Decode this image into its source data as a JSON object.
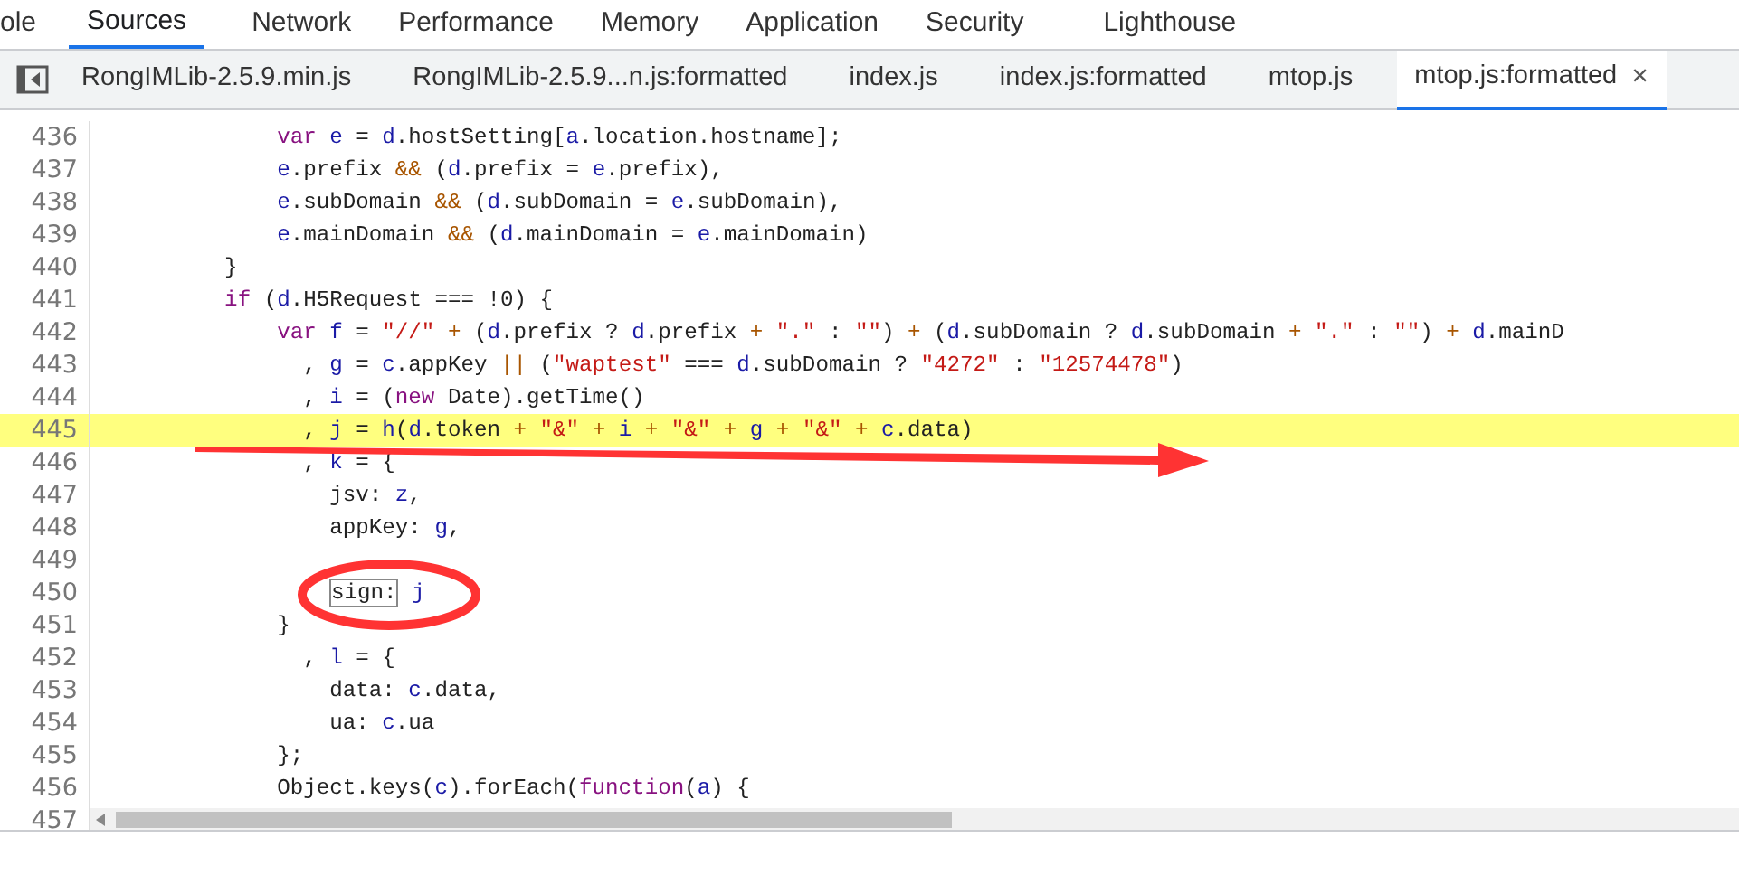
{
  "panel_tabs": [
    {
      "label": "ole",
      "selected": false
    },
    {
      "label": "Sources",
      "selected": true
    },
    {
      "label": "Network",
      "selected": false
    },
    {
      "label": "Performance",
      "selected": false
    },
    {
      "label": "Memory",
      "selected": false
    },
    {
      "label": "Application",
      "selected": false
    },
    {
      "label": "Security",
      "selected": false
    },
    {
      "label": "Lighthouse",
      "selected": false
    }
  ],
  "file_tabs": [
    {
      "label": "RongIMLib-2.5.9.min.js",
      "selected": false
    },
    {
      "label": "RongIMLib-2.5.9...n.js:formatted",
      "selected": false
    },
    {
      "label": "index.js",
      "selected": false
    },
    {
      "label": "index.js:formatted",
      "selected": false
    },
    {
      "label": "mtop.js",
      "selected": false
    },
    {
      "label": "mtop.js:formatted",
      "selected": true,
      "close": "×"
    }
  ],
  "code_lines": [
    {
      "number": "436",
      "highlighted": false,
      "segments": [
        {
          "kind": "kw",
          "t": "            var "
        },
        {
          "kind": "var",
          "t": "e "
        },
        {
          "kind": "plain",
          "t": "= "
        },
        {
          "kind": "var",
          "t": "d"
        },
        {
          "kind": "plain",
          "t": ".hostSetting["
        },
        {
          "kind": "var",
          "t": "a"
        },
        {
          "kind": "plain",
          "t": ".location.hostname];"
        }
      ]
    },
    {
      "number": "437",
      "highlighted": false,
      "segments": [
        {
          "kind": "var",
          "t": "            e"
        },
        {
          "kind": "plain",
          "t": ".prefix "
        },
        {
          "kind": "op",
          "t": "&& "
        },
        {
          "kind": "plain",
          "t": "("
        },
        {
          "kind": "var",
          "t": "d"
        },
        {
          "kind": "plain",
          "t": ".prefix = "
        },
        {
          "kind": "var",
          "t": "e"
        },
        {
          "kind": "plain",
          "t": ".prefix),"
        }
      ]
    },
    {
      "number": "438",
      "highlighted": false,
      "segments": [
        {
          "kind": "var",
          "t": "            e"
        },
        {
          "kind": "plain",
          "t": ".subDomain "
        },
        {
          "kind": "op",
          "t": "&& "
        },
        {
          "kind": "plain",
          "t": "("
        },
        {
          "kind": "var",
          "t": "d"
        },
        {
          "kind": "plain",
          "t": ".subDomain = "
        },
        {
          "kind": "var",
          "t": "e"
        },
        {
          "kind": "plain",
          "t": ".subDomain),"
        }
      ]
    },
    {
      "number": "439",
      "highlighted": false,
      "segments": [
        {
          "kind": "var",
          "t": "            e"
        },
        {
          "kind": "plain",
          "t": ".mainDomain "
        },
        {
          "kind": "op",
          "t": "&& "
        },
        {
          "kind": "plain",
          "t": "("
        },
        {
          "kind": "var",
          "t": "d"
        },
        {
          "kind": "plain",
          "t": ".mainDomain = "
        },
        {
          "kind": "var",
          "t": "e"
        },
        {
          "kind": "plain",
          "t": ".mainDomain)"
        }
      ]
    },
    {
      "number": "440",
      "highlighted": false,
      "segments": [
        {
          "kind": "plain",
          "t": "        }"
        }
      ]
    },
    {
      "number": "441",
      "highlighted": false,
      "segments": [
        {
          "kind": "kw",
          "t": "        if "
        },
        {
          "kind": "plain",
          "t": "("
        },
        {
          "kind": "var",
          "t": "d"
        },
        {
          "kind": "plain",
          "t": ".H5Request === !0) {"
        }
      ]
    },
    {
      "number": "442",
      "highlighted": false,
      "segments": [
        {
          "kind": "kw",
          "t": "            var "
        },
        {
          "kind": "var",
          "t": "f "
        },
        {
          "kind": "plain",
          "t": "= "
        },
        {
          "kind": "str",
          "t": "\"//\" "
        },
        {
          "kind": "op",
          "t": "+ "
        },
        {
          "kind": "plain",
          "t": "("
        },
        {
          "kind": "var",
          "t": "d"
        },
        {
          "kind": "plain",
          "t": ".prefix ? "
        },
        {
          "kind": "var",
          "t": "d"
        },
        {
          "kind": "plain",
          "t": ".prefix "
        },
        {
          "kind": "op",
          "t": "+ "
        },
        {
          "kind": "str",
          "t": "\".\" "
        },
        {
          "kind": "plain",
          "t": ": "
        },
        {
          "kind": "str",
          "t": "\"\""
        },
        {
          "kind": "plain",
          "t": ") "
        },
        {
          "kind": "op",
          "t": "+ "
        },
        {
          "kind": "plain",
          "t": "("
        },
        {
          "kind": "var",
          "t": "d"
        },
        {
          "kind": "plain",
          "t": ".subDomain ? "
        },
        {
          "kind": "var",
          "t": "d"
        },
        {
          "kind": "plain",
          "t": ".subDomain "
        },
        {
          "kind": "op",
          "t": "+ "
        },
        {
          "kind": "str",
          "t": "\".\" "
        },
        {
          "kind": "plain",
          "t": ": "
        },
        {
          "kind": "str",
          "t": "\"\""
        },
        {
          "kind": "plain",
          "t": ") "
        },
        {
          "kind": "op",
          "t": "+ "
        },
        {
          "kind": "var",
          "t": "d"
        },
        {
          "kind": "plain",
          "t": ".mainD"
        }
      ]
    },
    {
      "number": "443",
      "highlighted": false,
      "segments": [
        {
          "kind": "plain",
          "t": "              , "
        },
        {
          "kind": "var",
          "t": "g "
        },
        {
          "kind": "plain",
          "t": "= "
        },
        {
          "kind": "var",
          "t": "c"
        },
        {
          "kind": "plain",
          "t": ".appKey "
        },
        {
          "kind": "op",
          "t": "|| "
        },
        {
          "kind": "plain",
          "t": "("
        },
        {
          "kind": "str",
          "t": "\"waptest\" "
        },
        {
          "kind": "plain",
          "t": "=== "
        },
        {
          "kind": "var",
          "t": "d"
        },
        {
          "kind": "plain",
          "t": ".subDomain ? "
        },
        {
          "kind": "str",
          "t": "\"4272\" "
        },
        {
          "kind": "plain",
          "t": ": "
        },
        {
          "kind": "str",
          "t": "\"12574478\""
        },
        {
          "kind": "plain",
          "t": ")"
        }
      ]
    },
    {
      "number": "444",
      "highlighted": false,
      "segments": [
        {
          "kind": "plain",
          "t": "              , "
        },
        {
          "kind": "var",
          "t": "i "
        },
        {
          "kind": "plain",
          "t": "= ("
        },
        {
          "kind": "kw",
          "t": "new "
        },
        {
          "kind": "plain",
          "t": "Date).getTime()"
        }
      ]
    },
    {
      "number": "445",
      "highlighted": true,
      "segments": [
        {
          "kind": "plain",
          "t": "              , "
        },
        {
          "kind": "var",
          "t": "j "
        },
        {
          "kind": "plain",
          "t": "= "
        },
        {
          "kind": "var",
          "t": "h"
        },
        {
          "kind": "plain",
          "t": "("
        },
        {
          "kind": "var",
          "t": "d"
        },
        {
          "kind": "plain",
          "t": ".token "
        },
        {
          "kind": "op",
          "t": "+ "
        },
        {
          "kind": "str",
          "t": "\"&\" "
        },
        {
          "kind": "op",
          "t": "+ "
        },
        {
          "kind": "var",
          "t": "i "
        },
        {
          "kind": "op",
          "t": "+ "
        },
        {
          "kind": "str",
          "t": "\"&\" "
        },
        {
          "kind": "op",
          "t": "+ "
        },
        {
          "kind": "var",
          "t": "g "
        },
        {
          "kind": "op",
          "t": "+ "
        },
        {
          "kind": "str",
          "t": "\"&\" "
        },
        {
          "kind": "op",
          "t": "+ "
        },
        {
          "kind": "var",
          "t": "c"
        },
        {
          "kind": "plain",
          "t": ".data)"
        }
      ]
    },
    {
      "number": "446",
      "highlighted": false,
      "segments": [
        {
          "kind": "plain",
          "t": "              , "
        },
        {
          "kind": "var",
          "t": "k "
        },
        {
          "kind": "plain",
          "t": "= {"
        }
      ]
    },
    {
      "number": "447",
      "highlighted": false,
      "segments": [
        {
          "kind": "plain",
          "t": "                jsv: "
        },
        {
          "kind": "var",
          "t": "z"
        },
        {
          "kind": "plain",
          "t": ","
        }
      ]
    },
    {
      "number": "448",
      "highlighted": false,
      "segments": [
        {
          "kind": "plain",
          "t": "                appKey: "
        },
        {
          "kind": "var",
          "t": "g"
        },
        {
          "kind": "plain",
          "t": ","
        }
      ]
    },
    {
      "number": "449",
      "highlighted": false
    },
    {
      "number": "450",
      "highlighted": false,
      "segments": [
        {
          "kind": "match",
          "t": "sign:"
        },
        {
          "kind": "var",
          "t": " j"
        }
      ]
    },
    {
      "number": "451",
      "highlighted": false,
      "segments": [
        {
          "kind": "plain",
          "t": "            }"
        }
      ]
    },
    {
      "number": "452",
      "highlighted": false,
      "segments": [
        {
          "kind": "plain",
          "t": "              , "
        },
        {
          "kind": "var",
          "t": "l "
        },
        {
          "kind": "plain",
          "t": "= {"
        }
      ]
    },
    {
      "number": "453",
      "highlighted": false,
      "segments": [
        {
          "kind": "plain",
          "t": "                data: "
        },
        {
          "kind": "var",
          "t": "c"
        },
        {
          "kind": "plain",
          "t": ".data,"
        }
      ]
    },
    {
      "number": "454",
      "highlighted": false,
      "segments": [
        {
          "kind": "plain",
          "t": "                ua: "
        },
        {
          "kind": "var",
          "t": "c"
        },
        {
          "kind": "plain",
          "t": ".ua"
        }
      ]
    },
    {
      "number": "455",
      "highlighted": false,
      "segments": [
        {
          "kind": "plain",
          "t": "            };"
        }
      ]
    },
    {
      "number": "456",
      "highlighted": false,
      "segments": [
        {
          "kind": "plain",
          "t": "            Object.keys("
        },
        {
          "kind": "var",
          "t": "c"
        },
        {
          "kind": "plain",
          "t": ").forEach("
        },
        {
          "kind": "kw",
          "t": "function"
        },
        {
          "kind": "plain",
          "t": "("
        },
        {
          "kind": "var",
          "t": "a"
        },
        {
          "kind": "plain",
          "t": ") {"
        }
      ]
    },
    {
      "number": "457",
      "highlighted": false
    }
  ]
}
